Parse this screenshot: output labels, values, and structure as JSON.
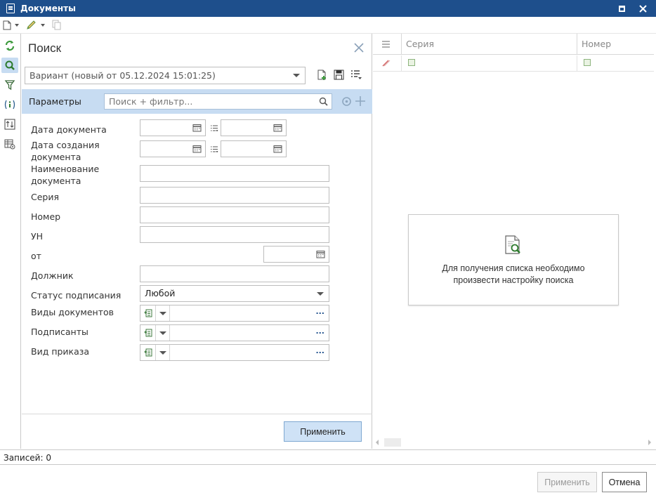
{
  "window": {
    "title": "Документы",
    "icons": {
      "app": "document-app-icon",
      "maximize": "maximize-icon",
      "close": "close-icon"
    }
  },
  "toolbar": {
    "items": [
      "new-document-icon",
      "edit-pencil-icon",
      "copy-icon"
    ]
  },
  "left_strip": {
    "items": [
      "refresh-icon",
      "search-icon",
      "filter-icon",
      "info-icon",
      "sort-icon",
      "grid-settings-icon"
    ],
    "active": "search-icon"
  },
  "search_panel": {
    "title": "Поиск",
    "variant": {
      "value": "Вариант (новый от 05.12.2024 15:01:25)"
    },
    "params": {
      "label": "Параметры",
      "search_placeholder": "Поиск + фильтр..."
    },
    "fields": {
      "doc_date": "Дата документа",
      "created_date": "Дата создания документа",
      "doc_name": "Наименование документа",
      "series": "Серия",
      "number": "Номер",
      "un": "УН",
      "from": "от",
      "debtor": "Должник",
      "sign_status": "Статус подписания",
      "sign_status_value": "Любой",
      "doc_types": "Виды документов",
      "signers": "Подписанты",
      "order_type": "Вид приказа",
      "ellipsis": "..."
    },
    "apply_label": "Применить"
  },
  "results": {
    "columns": [
      "Серия",
      "Номер"
    ],
    "empty_message_line1": "Для получения списка необходимо",
    "empty_message_line2": "произвести настройку поиска"
  },
  "status": {
    "records": "Записей: 0"
  },
  "footer": {
    "apply_label": "Применить",
    "cancel_label": "Отмена"
  },
  "colors": {
    "title_bar": "#1e4f8c",
    "params_bar": "#c7dcf2",
    "primary_button": "#cfe2f6"
  }
}
